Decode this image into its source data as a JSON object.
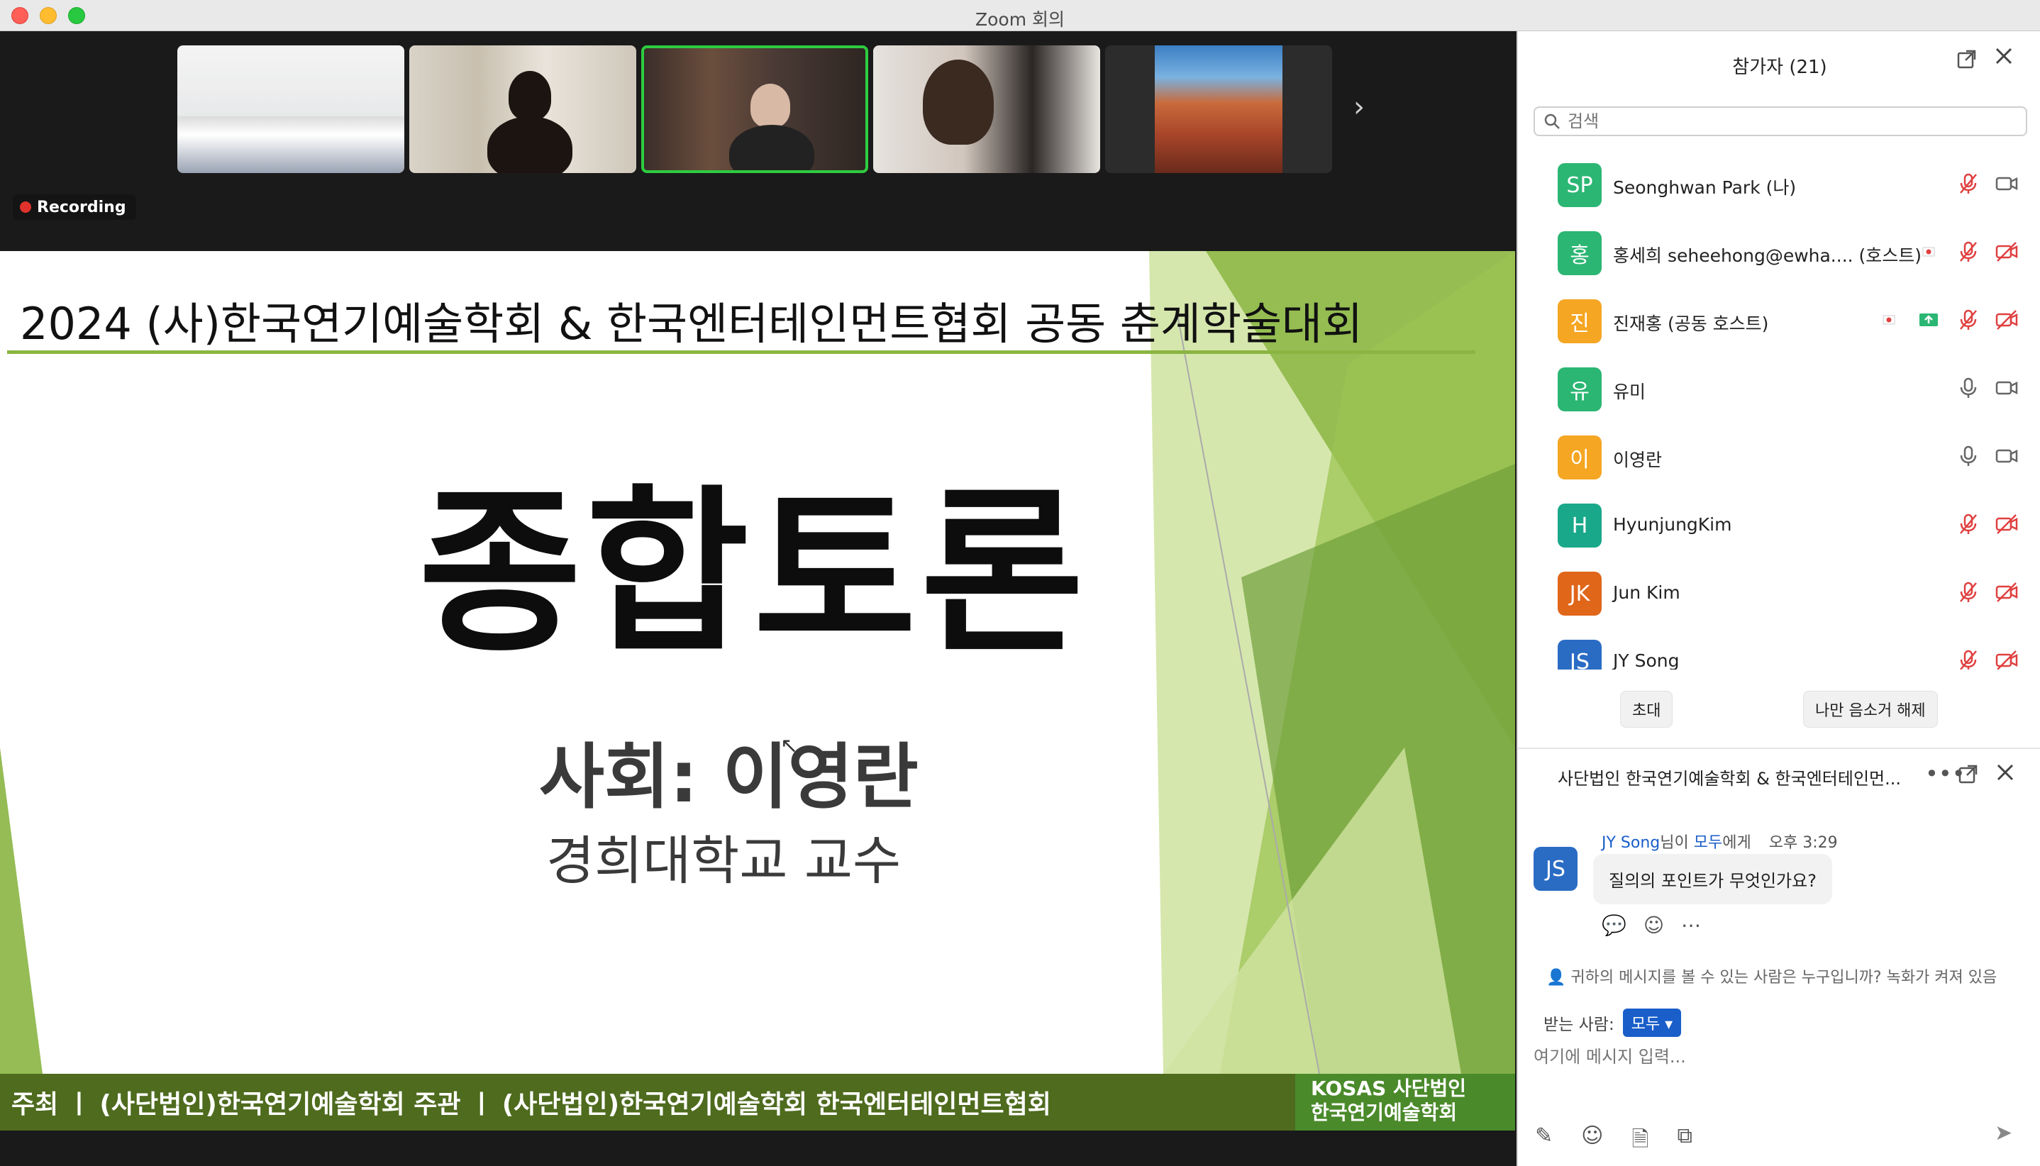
{
  "window": {
    "title": "Zoom 회의"
  },
  "video_strip": {
    "recording_label": "Recording",
    "thumbnails": [
      {
        "label": "empty room camera"
      },
      {
        "label": "participant video"
      },
      {
        "label": "active speaker video"
      },
      {
        "label": "participant video"
      },
      {
        "label": "landscape image"
      }
    ]
  },
  "slide": {
    "title": "2024 (사)한국연기예술학회 & 한국엔터테인먼트협회 공동 춘계학술대회",
    "heading": "종합토론",
    "moderator": "사회: 이영란",
    "affiliation": "경희대학교 교수",
    "footer": "주최 ㅣ (사단법인)한국연기예술학회   주관 ㅣ (사단법인)한국연기예술학회   한국엔터테인먼트협회",
    "logo_line1": "KOSAS 사단법인",
    "logo_line2": "한국연기예술학회"
  },
  "participants_panel": {
    "title": "참가자 (21)",
    "search_placeholder": "검색",
    "participants": [
      {
        "initials": "SP",
        "name": "Seonghwan Park (나)",
        "color": "#2bb673",
        "audio": "muted",
        "video": "on"
      },
      {
        "initials": "홍",
        "name": "홍세희 seheehong@ewha....  (호스트)",
        "color": "#2bb673",
        "audio": "muted",
        "video": "off",
        "extra": "flag"
      },
      {
        "initials": "진",
        "name": "진재홍 (공동 호스트)",
        "color": "#f5a623",
        "audio": "muted",
        "video": "off",
        "extra": "flag-share"
      },
      {
        "initials": "유",
        "name": "유미",
        "color": "#2bb673",
        "audio": "on",
        "video": "on"
      },
      {
        "initials": "이",
        "name": "이영란",
        "color": "#f5a623",
        "audio": "on",
        "video": "on"
      },
      {
        "initials": "H",
        "name": "HyunjungKim",
        "color": "#1aa88a",
        "audio": "muted",
        "video": "off"
      },
      {
        "initials": "JK",
        "name": "Jun Kim",
        "color": "#e0661a",
        "audio": "muted",
        "video": "off"
      },
      {
        "initials": "JS",
        "name": "JY Song",
        "color": "#2a6cc4",
        "audio": "muted",
        "video": "off"
      }
    ],
    "invite_label": "초대",
    "unmute_label": "나만 음소거 해제"
  },
  "chat": {
    "title": "사단법인 한국연기예술학회 & 한국엔터테인먼...",
    "message": {
      "avatar": "JS",
      "sender": "JY Song",
      "mid": "님이 ",
      "to": "모두",
      "suffix": "에게",
      "time": "오후 3:29",
      "text": "질의의 포인트가 무엇인가요?"
    },
    "notice": "귀하의 메시지를 볼 수 있는 사람은 누구입니까? 녹화가 켜져 있음",
    "recipient_label": "받는 사람:",
    "recipient_value": "모두",
    "input_placeholder": "여기에 메시지 입력..."
  },
  "colors": {
    "slide_green": "#8ab542",
    "footer_green": "#4e6b1e",
    "accent_blue": "#1a5ec9",
    "mute_red": "#e04040",
    "recording_red": "#e0322c"
  }
}
